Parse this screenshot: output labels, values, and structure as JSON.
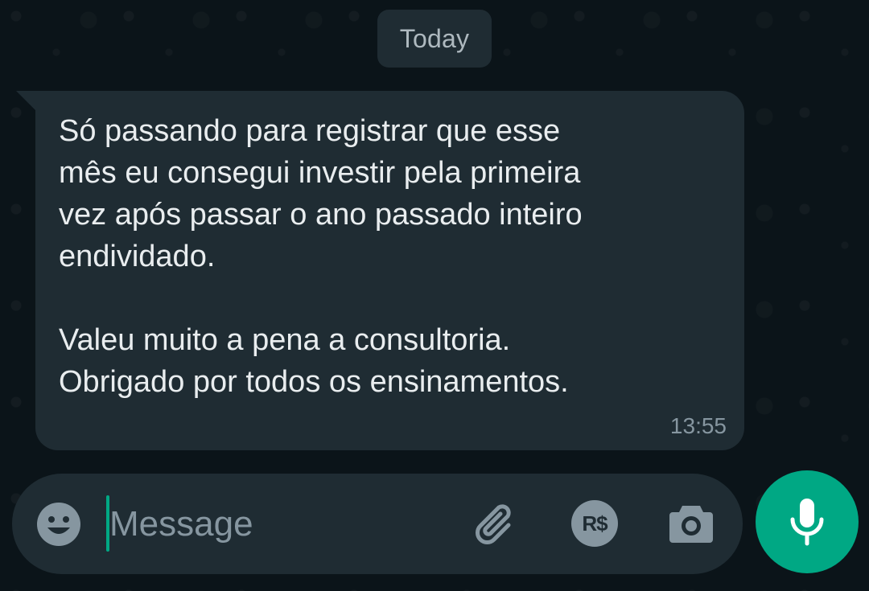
{
  "chat": {
    "date_separator": "Today",
    "message": {
      "text": "Só passando para registrar que esse\nmês eu consegui investir pela primeira\nvez após passar o ano passado inteiro\nendividado.\n\nValeu muito a pena a consultoria.\nObrigado por todos os ensinamentos.",
      "time": "13:55"
    }
  },
  "composer": {
    "placeholder": "Message",
    "value": "",
    "payment_label": "R$",
    "icons": [
      "emoji-icon",
      "paperclip-icon",
      "payment-icon",
      "camera-icon",
      "mic-icon"
    ]
  },
  "colors": {
    "background": "#0b1419",
    "bubble": "#1f2c33",
    "text": "#e9edef",
    "muted": "#8696a0",
    "accent": "#00a884"
  }
}
